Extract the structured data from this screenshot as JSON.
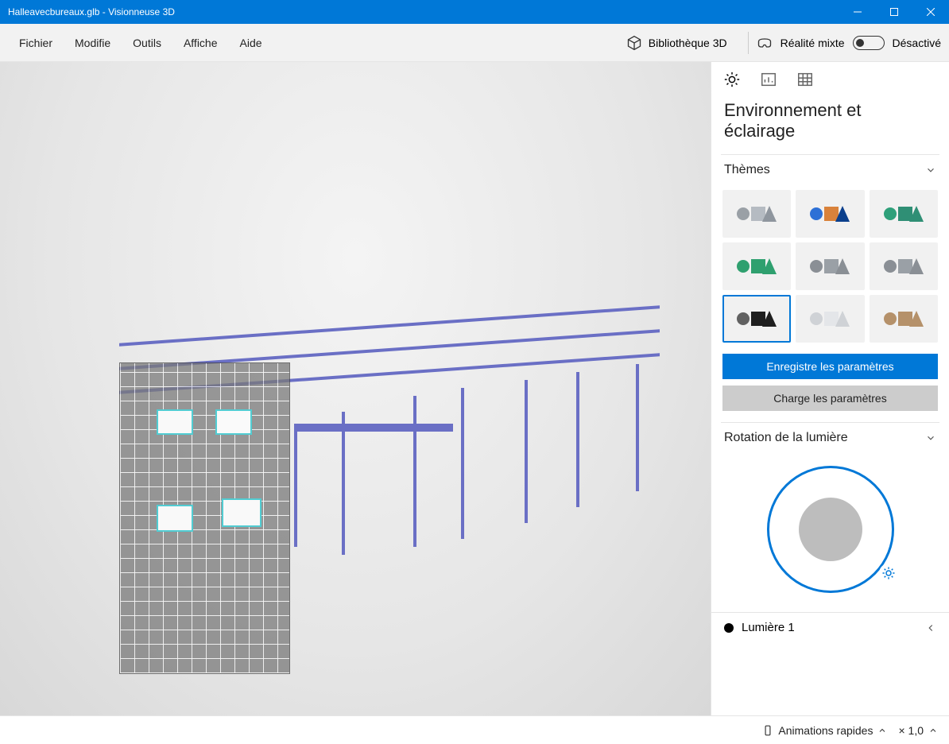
{
  "window": {
    "title": "Halleavecbureaux.glb - Visionneuse 3D"
  },
  "menu": {
    "items": [
      "Fichier",
      "Modifie",
      "Outils",
      "Affiche",
      "Aide"
    ],
    "library_3d": "Bibliothèque 3D",
    "mixed_reality_label": "Réalité mixte",
    "mixed_reality_state": "Désactivé"
  },
  "right_panel": {
    "tabs": {
      "active": "environment",
      "items": [
        "environment-icon",
        "stats-icon",
        "grid-icon"
      ]
    },
    "title": "Environnement et éclairage",
    "themes": {
      "label": "Thèmes",
      "tiles": [
        {
          "id": "theme-grey-1",
          "sphere": "#9aa0a6",
          "cube": "#b5bbc2",
          "cone": "#8f969e"
        },
        {
          "id": "theme-orange",
          "sphere": "#2d70d6",
          "cube": "#d9823b",
          "cone": "#0b3f8c"
        },
        {
          "id": "theme-teal",
          "sphere": "#2ea07a",
          "cube": "#2f8f75",
          "cone": "#2f8f75"
        },
        {
          "id": "theme-green",
          "sphere": "#2fa06f",
          "cube": "#2fa06f",
          "cone": "#2fa06f"
        },
        {
          "id": "theme-grey-2",
          "sphere": "#8a8f95",
          "cube": "#9aa0a6",
          "cone": "#8a8f95"
        },
        {
          "id": "theme-grey-3",
          "sphere": "#8a8f95",
          "cube": "#9aa0a6",
          "cone": "#8a8f95"
        },
        {
          "id": "theme-black",
          "sphere": "#616161",
          "cube": "#1f1f1f",
          "cone": "#1f1f1f",
          "selected": true
        },
        {
          "id": "theme-light",
          "sphere": "#cfd2d6",
          "cube": "#e4e6e9",
          "cone": "#cfd2d6"
        },
        {
          "id": "theme-bronze",
          "sphere": "#b5916a",
          "cube": "#b5916a",
          "cone": "#b5916a"
        }
      ],
      "save_label": "Enregistre les paramètres",
      "load_label": "Charge les paramètres"
    },
    "rotation": {
      "label": "Rotation de la lumière"
    },
    "lights": {
      "item_1": "Lumière 1"
    }
  },
  "statusbar": {
    "animations_label": "Animations rapides",
    "speed": "× 1,0"
  }
}
